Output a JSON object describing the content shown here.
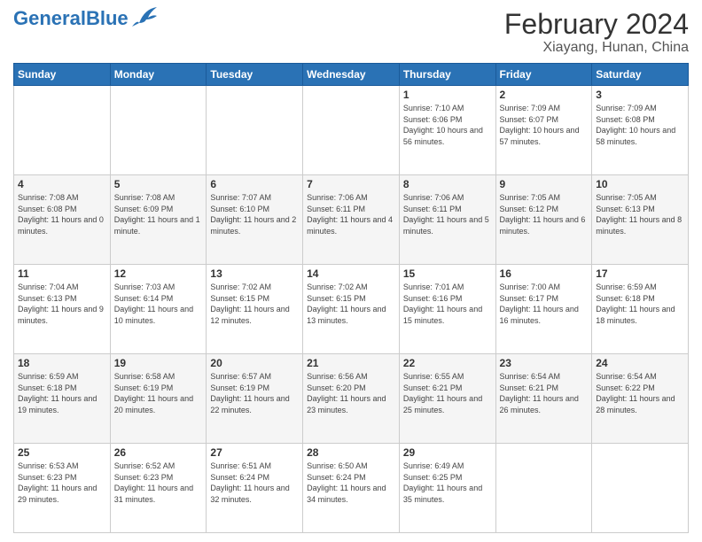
{
  "header": {
    "logo_general": "General",
    "logo_blue": "Blue",
    "main_title": "February 2024",
    "subtitle": "Xiayang, Hunan, China"
  },
  "days_of_week": [
    "Sunday",
    "Monday",
    "Tuesday",
    "Wednesday",
    "Thursday",
    "Friday",
    "Saturday"
  ],
  "weeks": [
    [
      {
        "day": "",
        "info": ""
      },
      {
        "day": "",
        "info": ""
      },
      {
        "day": "",
        "info": ""
      },
      {
        "day": "",
        "info": ""
      },
      {
        "day": "1",
        "info": "Sunrise: 7:10 AM\nSunset: 6:06 PM\nDaylight: 10 hours and 56 minutes."
      },
      {
        "day": "2",
        "info": "Sunrise: 7:09 AM\nSunset: 6:07 PM\nDaylight: 10 hours and 57 minutes."
      },
      {
        "day": "3",
        "info": "Sunrise: 7:09 AM\nSunset: 6:08 PM\nDaylight: 10 hours and 58 minutes."
      }
    ],
    [
      {
        "day": "4",
        "info": "Sunrise: 7:08 AM\nSunset: 6:08 PM\nDaylight: 11 hours and 0 minutes."
      },
      {
        "day": "5",
        "info": "Sunrise: 7:08 AM\nSunset: 6:09 PM\nDaylight: 11 hours and 1 minute."
      },
      {
        "day": "6",
        "info": "Sunrise: 7:07 AM\nSunset: 6:10 PM\nDaylight: 11 hours and 2 minutes."
      },
      {
        "day": "7",
        "info": "Sunrise: 7:06 AM\nSunset: 6:11 PM\nDaylight: 11 hours and 4 minutes."
      },
      {
        "day": "8",
        "info": "Sunrise: 7:06 AM\nSunset: 6:11 PM\nDaylight: 11 hours and 5 minutes."
      },
      {
        "day": "9",
        "info": "Sunrise: 7:05 AM\nSunset: 6:12 PM\nDaylight: 11 hours and 6 minutes."
      },
      {
        "day": "10",
        "info": "Sunrise: 7:05 AM\nSunset: 6:13 PM\nDaylight: 11 hours and 8 minutes."
      }
    ],
    [
      {
        "day": "11",
        "info": "Sunrise: 7:04 AM\nSunset: 6:13 PM\nDaylight: 11 hours and 9 minutes."
      },
      {
        "day": "12",
        "info": "Sunrise: 7:03 AM\nSunset: 6:14 PM\nDaylight: 11 hours and 10 minutes."
      },
      {
        "day": "13",
        "info": "Sunrise: 7:02 AM\nSunset: 6:15 PM\nDaylight: 11 hours and 12 minutes."
      },
      {
        "day": "14",
        "info": "Sunrise: 7:02 AM\nSunset: 6:15 PM\nDaylight: 11 hours and 13 minutes."
      },
      {
        "day": "15",
        "info": "Sunrise: 7:01 AM\nSunset: 6:16 PM\nDaylight: 11 hours and 15 minutes."
      },
      {
        "day": "16",
        "info": "Sunrise: 7:00 AM\nSunset: 6:17 PM\nDaylight: 11 hours and 16 minutes."
      },
      {
        "day": "17",
        "info": "Sunrise: 6:59 AM\nSunset: 6:18 PM\nDaylight: 11 hours and 18 minutes."
      }
    ],
    [
      {
        "day": "18",
        "info": "Sunrise: 6:59 AM\nSunset: 6:18 PM\nDaylight: 11 hours and 19 minutes."
      },
      {
        "day": "19",
        "info": "Sunrise: 6:58 AM\nSunset: 6:19 PM\nDaylight: 11 hours and 20 minutes."
      },
      {
        "day": "20",
        "info": "Sunrise: 6:57 AM\nSunset: 6:19 PM\nDaylight: 11 hours and 22 minutes."
      },
      {
        "day": "21",
        "info": "Sunrise: 6:56 AM\nSunset: 6:20 PM\nDaylight: 11 hours and 23 minutes."
      },
      {
        "day": "22",
        "info": "Sunrise: 6:55 AM\nSunset: 6:21 PM\nDaylight: 11 hours and 25 minutes."
      },
      {
        "day": "23",
        "info": "Sunrise: 6:54 AM\nSunset: 6:21 PM\nDaylight: 11 hours and 26 minutes."
      },
      {
        "day": "24",
        "info": "Sunrise: 6:54 AM\nSunset: 6:22 PM\nDaylight: 11 hours and 28 minutes."
      }
    ],
    [
      {
        "day": "25",
        "info": "Sunrise: 6:53 AM\nSunset: 6:23 PM\nDaylight: 11 hours and 29 minutes."
      },
      {
        "day": "26",
        "info": "Sunrise: 6:52 AM\nSunset: 6:23 PM\nDaylight: 11 hours and 31 minutes."
      },
      {
        "day": "27",
        "info": "Sunrise: 6:51 AM\nSunset: 6:24 PM\nDaylight: 11 hours and 32 minutes."
      },
      {
        "day": "28",
        "info": "Sunrise: 6:50 AM\nSunset: 6:24 PM\nDaylight: 11 hours and 34 minutes."
      },
      {
        "day": "29",
        "info": "Sunrise: 6:49 AM\nSunset: 6:25 PM\nDaylight: 11 hours and 35 minutes."
      },
      {
        "day": "",
        "info": ""
      },
      {
        "day": "",
        "info": ""
      }
    ]
  ]
}
